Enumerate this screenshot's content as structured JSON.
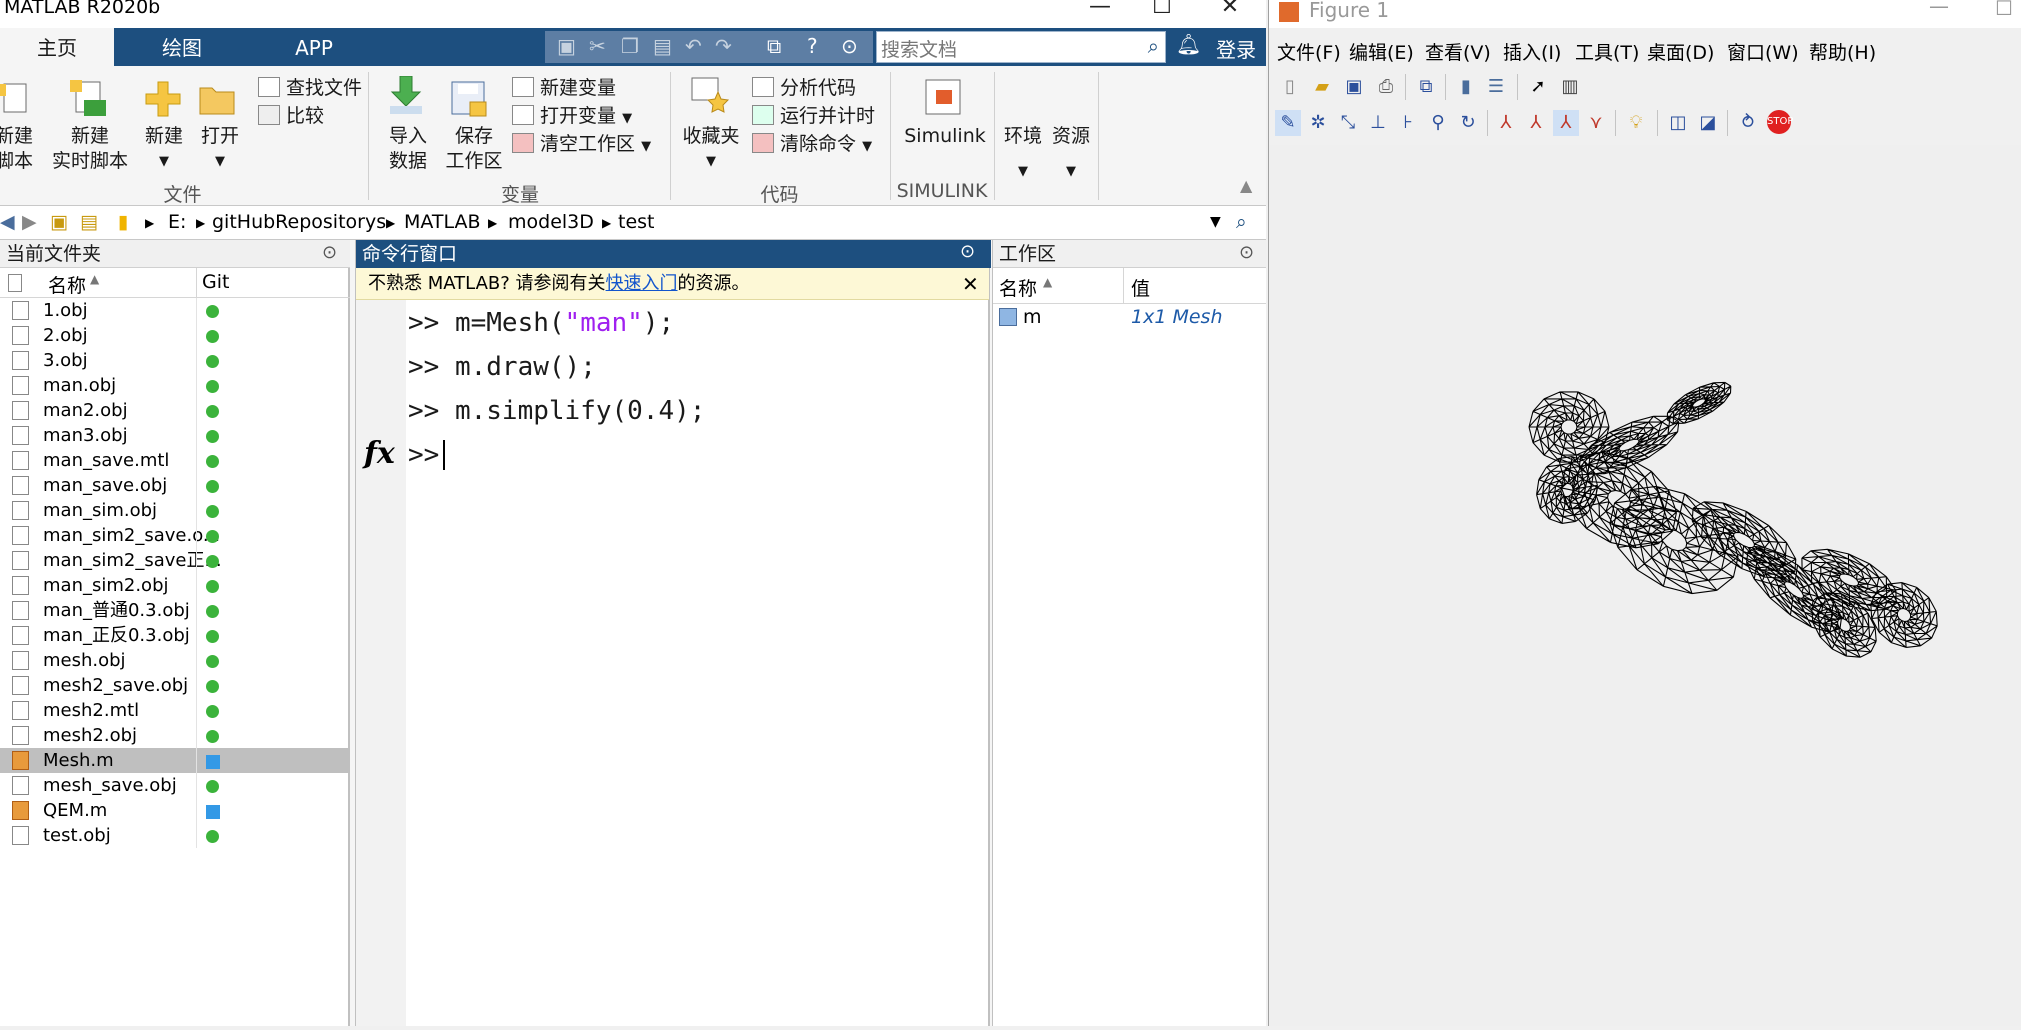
{
  "matlab": {
    "title": "MATLAB R2020b",
    "tabs": [
      "主页",
      "绘图",
      "APP"
    ],
    "search_placeholder": "搜索文档",
    "login": "登录",
    "ribbon": {
      "file": {
        "group": "文件",
        "new_script": [
          "新建",
          "脚本"
        ],
        "new_live_script": [
          "新建",
          "实时脚本"
        ],
        "new": "新建",
        "open": "打开",
        "find_files": "查找文件",
        "compare": "比较"
      },
      "variable": {
        "group": "变量",
        "import": [
          "导入",
          "数据"
        ],
        "save": [
          "保存",
          "工作区"
        ],
        "new_variable": "新建变量",
        "open_variable": "打开变量",
        "clear_workspace": "清空工作区"
      },
      "code": {
        "group": "代码",
        "favorites": "收藏夹",
        "analyze": "分析代码",
        "run_time": "运行并计时",
        "clear_commands": "清除命令"
      },
      "simulink": {
        "group": "SIMULINK",
        "label": "Simulink"
      },
      "environment": "环境",
      "resources": "资源"
    },
    "address": [
      "E:",
      "gitHubRepositorys",
      "MATLAB",
      "model3D",
      "test"
    ],
    "current_folder": {
      "title": "当前文件夹",
      "col_name": "名称",
      "col_git": "Git",
      "files": [
        {
          "name": "1.obj",
          "type": "obj",
          "git": "green"
        },
        {
          "name": "2.obj",
          "type": "obj",
          "git": "green"
        },
        {
          "name": "3.obj",
          "type": "obj",
          "git": "green"
        },
        {
          "name": "man.obj",
          "type": "obj",
          "git": "green"
        },
        {
          "name": "man2.obj",
          "type": "obj",
          "git": "green"
        },
        {
          "name": "man3.obj",
          "type": "obj",
          "git": "green"
        },
        {
          "name": "man_save.mtl",
          "type": "mtl",
          "git": "green"
        },
        {
          "name": "man_save.obj",
          "type": "obj",
          "git": "green"
        },
        {
          "name": "man_sim.obj",
          "type": "obj",
          "git": "green"
        },
        {
          "name": "man_sim2_save.o...",
          "type": "obj",
          "git": "green"
        },
        {
          "name": "man_sim2_save正...",
          "type": "obj",
          "git": "green"
        },
        {
          "name": "man_sim2.obj",
          "type": "obj",
          "git": "green"
        },
        {
          "name": "man_普通0.3.obj",
          "type": "obj",
          "git": "green"
        },
        {
          "name": "man_正反0.3.obj",
          "type": "obj",
          "git": "green"
        },
        {
          "name": "mesh.obj",
          "type": "obj",
          "git": "green"
        },
        {
          "name": "mesh2_save.obj",
          "type": "obj",
          "git": "green"
        },
        {
          "name": "mesh2.mtl",
          "type": "mtl",
          "git": "green"
        },
        {
          "name": "mesh2.obj",
          "type": "obj",
          "git": "green"
        },
        {
          "name": "Mesh.m",
          "type": "m",
          "git": "blue",
          "selected": true
        },
        {
          "name": "mesh_save.obj",
          "type": "obj",
          "git": "green"
        },
        {
          "name": "QEM.m",
          "type": "m",
          "git": "blue"
        },
        {
          "name": "test.obj",
          "type": "obj",
          "git": "green"
        }
      ]
    },
    "command_window": {
      "title": "命令行窗口",
      "tip_before": "不熟悉 MATLAB? 请参阅有关",
      "tip_link": "快速入门",
      "tip_after": "的资源。",
      "lines": [
        {
          "prompt": ">>",
          "code_a": "m=Mesh(",
          "str": "\"man\"",
          "code_b": ");"
        },
        {
          "prompt": ">>",
          "code_a": "m.draw();",
          "str": "",
          "code_b": ""
        },
        {
          "prompt": ">>",
          "code_a": "m.simplify(0.4);",
          "str": "",
          "code_b": ""
        }
      ],
      "fx": "fx",
      "current_prompt": ">>"
    },
    "workspace": {
      "title": "工作区",
      "col_name": "名称",
      "col_value": "值",
      "vars": [
        {
          "name": "m",
          "value": "1x1 Mesh"
        }
      ]
    }
  },
  "figure": {
    "title": "Figure 1",
    "menu": [
      "文件(F)",
      "编辑(E)",
      "查看(V)",
      "插入(I)",
      "工具(T)",
      "桌面(D)",
      "窗口(W)",
      "帮助(H)"
    ]
  },
  "colors": {
    "matlab_blue": "#1d4f7f",
    "git_green": "#3bb33b",
    "git_blue": "#3399e6",
    "string_purple": "#a020f0"
  }
}
